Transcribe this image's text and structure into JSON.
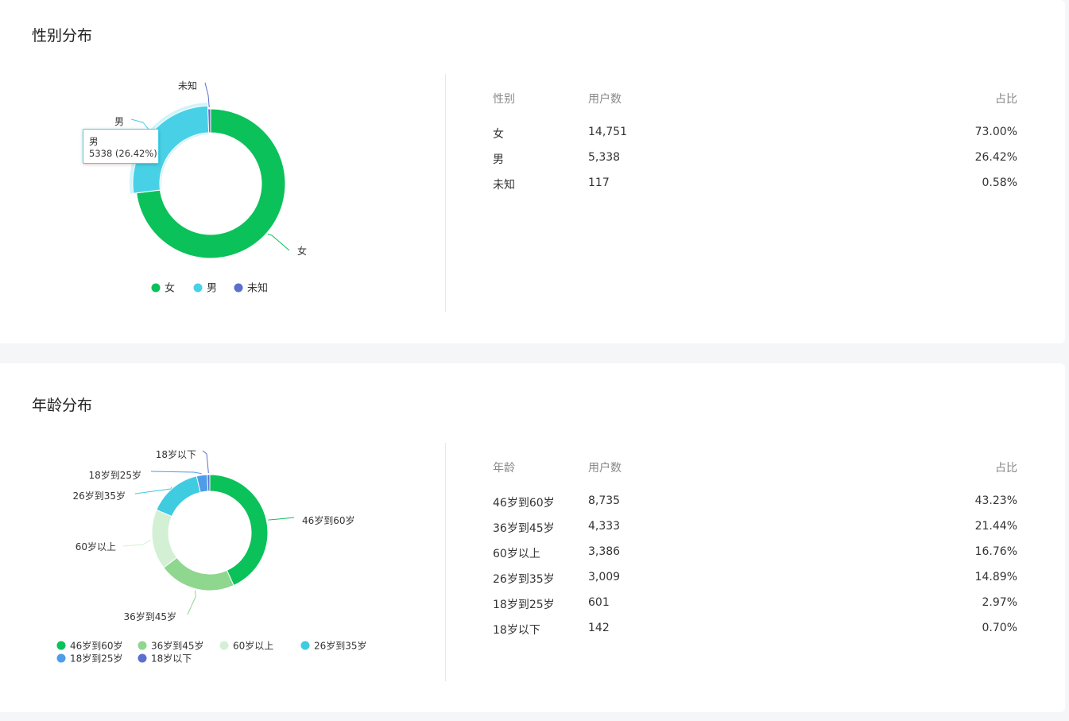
{
  "gender": {
    "title": "性别分布",
    "table": {
      "headers": [
        "性别",
        "用户数",
        "占比"
      ],
      "rows": [
        [
          "女",
          "14,751",
          "73.00%"
        ],
        [
          "男",
          "5,338",
          "26.42%"
        ],
        [
          "未知",
          "117",
          "0.58%"
        ]
      ]
    },
    "tooltip": {
      "name": "男",
      "detail": "5338 (26.42%)"
    }
  },
  "age": {
    "title": "年龄分布",
    "table": {
      "headers": [
        "年龄",
        "用户数",
        "占比"
      ],
      "rows": [
        [
          "46岁到60岁",
          "8,735",
          "43.23%"
        ],
        [
          "36岁到45岁",
          "4,333",
          "21.44%"
        ],
        [
          "60岁以上",
          "3,386",
          "16.76%"
        ],
        [
          "26岁到35岁",
          "3,009",
          "14.89%"
        ],
        [
          "18岁到25岁",
          "601",
          "2.97%"
        ],
        [
          "18岁以下",
          "142",
          "0.70%"
        ]
      ]
    }
  },
  "chart_data": [
    {
      "type": "pie",
      "donut": true,
      "categories": [
        "女",
        "男",
        "未知"
      ],
      "values": [
        14751,
        5338,
        117
      ],
      "colors": [
        "#0ac15a",
        "#48d1e6",
        "#5b6fcf"
      ],
      "legend": "bottom"
    },
    {
      "type": "pie",
      "donut": true,
      "categories": [
        "46岁到60岁",
        "36岁到45岁",
        "60岁以上",
        "26岁到35岁",
        "18岁到25岁",
        "18岁以下"
      ],
      "values": [
        8735,
        4333,
        3386,
        3009,
        601,
        142
      ],
      "colors": [
        "#0ac15a",
        "#8fd68f",
        "#d3f0d5",
        "#3fcbe0",
        "#4e9de8",
        "#5b6fcf"
      ],
      "legend": "bottom"
    }
  ]
}
